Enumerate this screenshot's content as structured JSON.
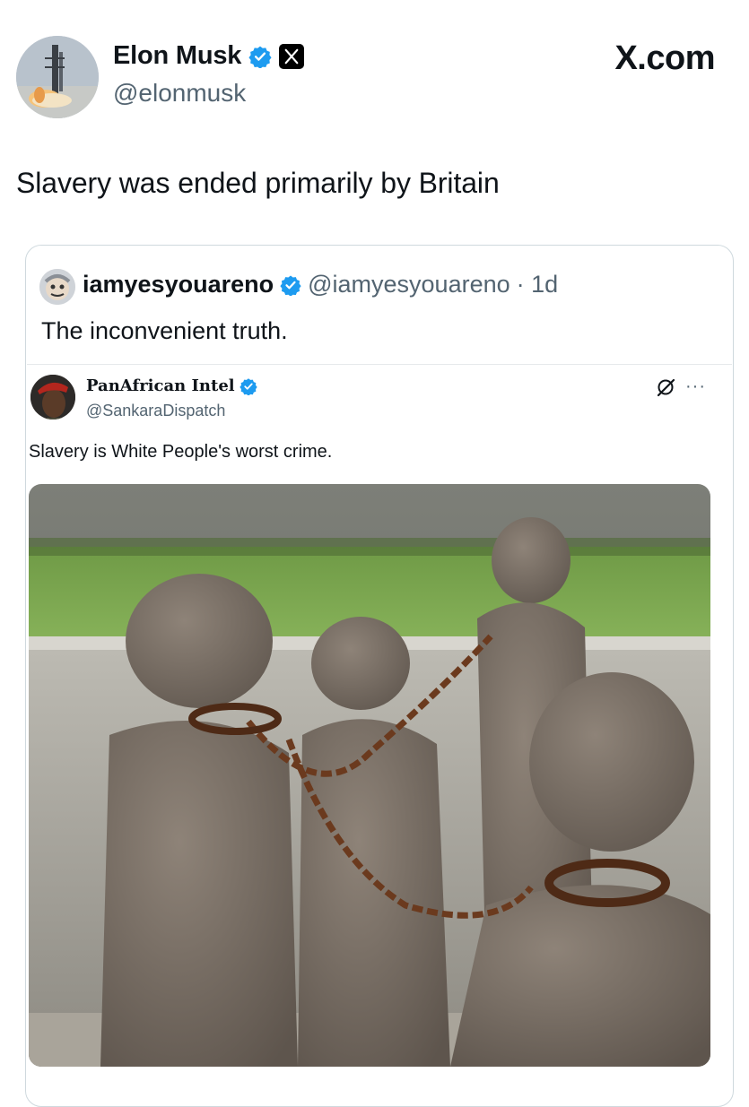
{
  "tweet": {
    "author_name": "Elon Musk",
    "author_handle": "@elonmusk",
    "brand": "X.com",
    "text": "Slavery was ended primarily by Britain",
    "avatar_icon": "rocket-launch-avatar",
    "badges": [
      "verified-badge-icon",
      "x-logo-icon"
    ]
  },
  "quote": {
    "author_name": "iamyesyouareno",
    "author_handle": "@iamyesyouareno",
    "time": "· 1d",
    "text": "The inconvenient truth."
  },
  "embedded": {
    "author_name": "PanAfrican Intel",
    "author_handle": "@SankaraDispatch",
    "text": "Slavery is White People's worst crime.",
    "menu_icon": "more-dots-icon",
    "grok_icon": "grok-icon",
    "more_label": "···"
  },
  "colors": {
    "verified": "#1d9bf0",
    "secondary_text": "#536471",
    "border": "#cfd9de"
  }
}
